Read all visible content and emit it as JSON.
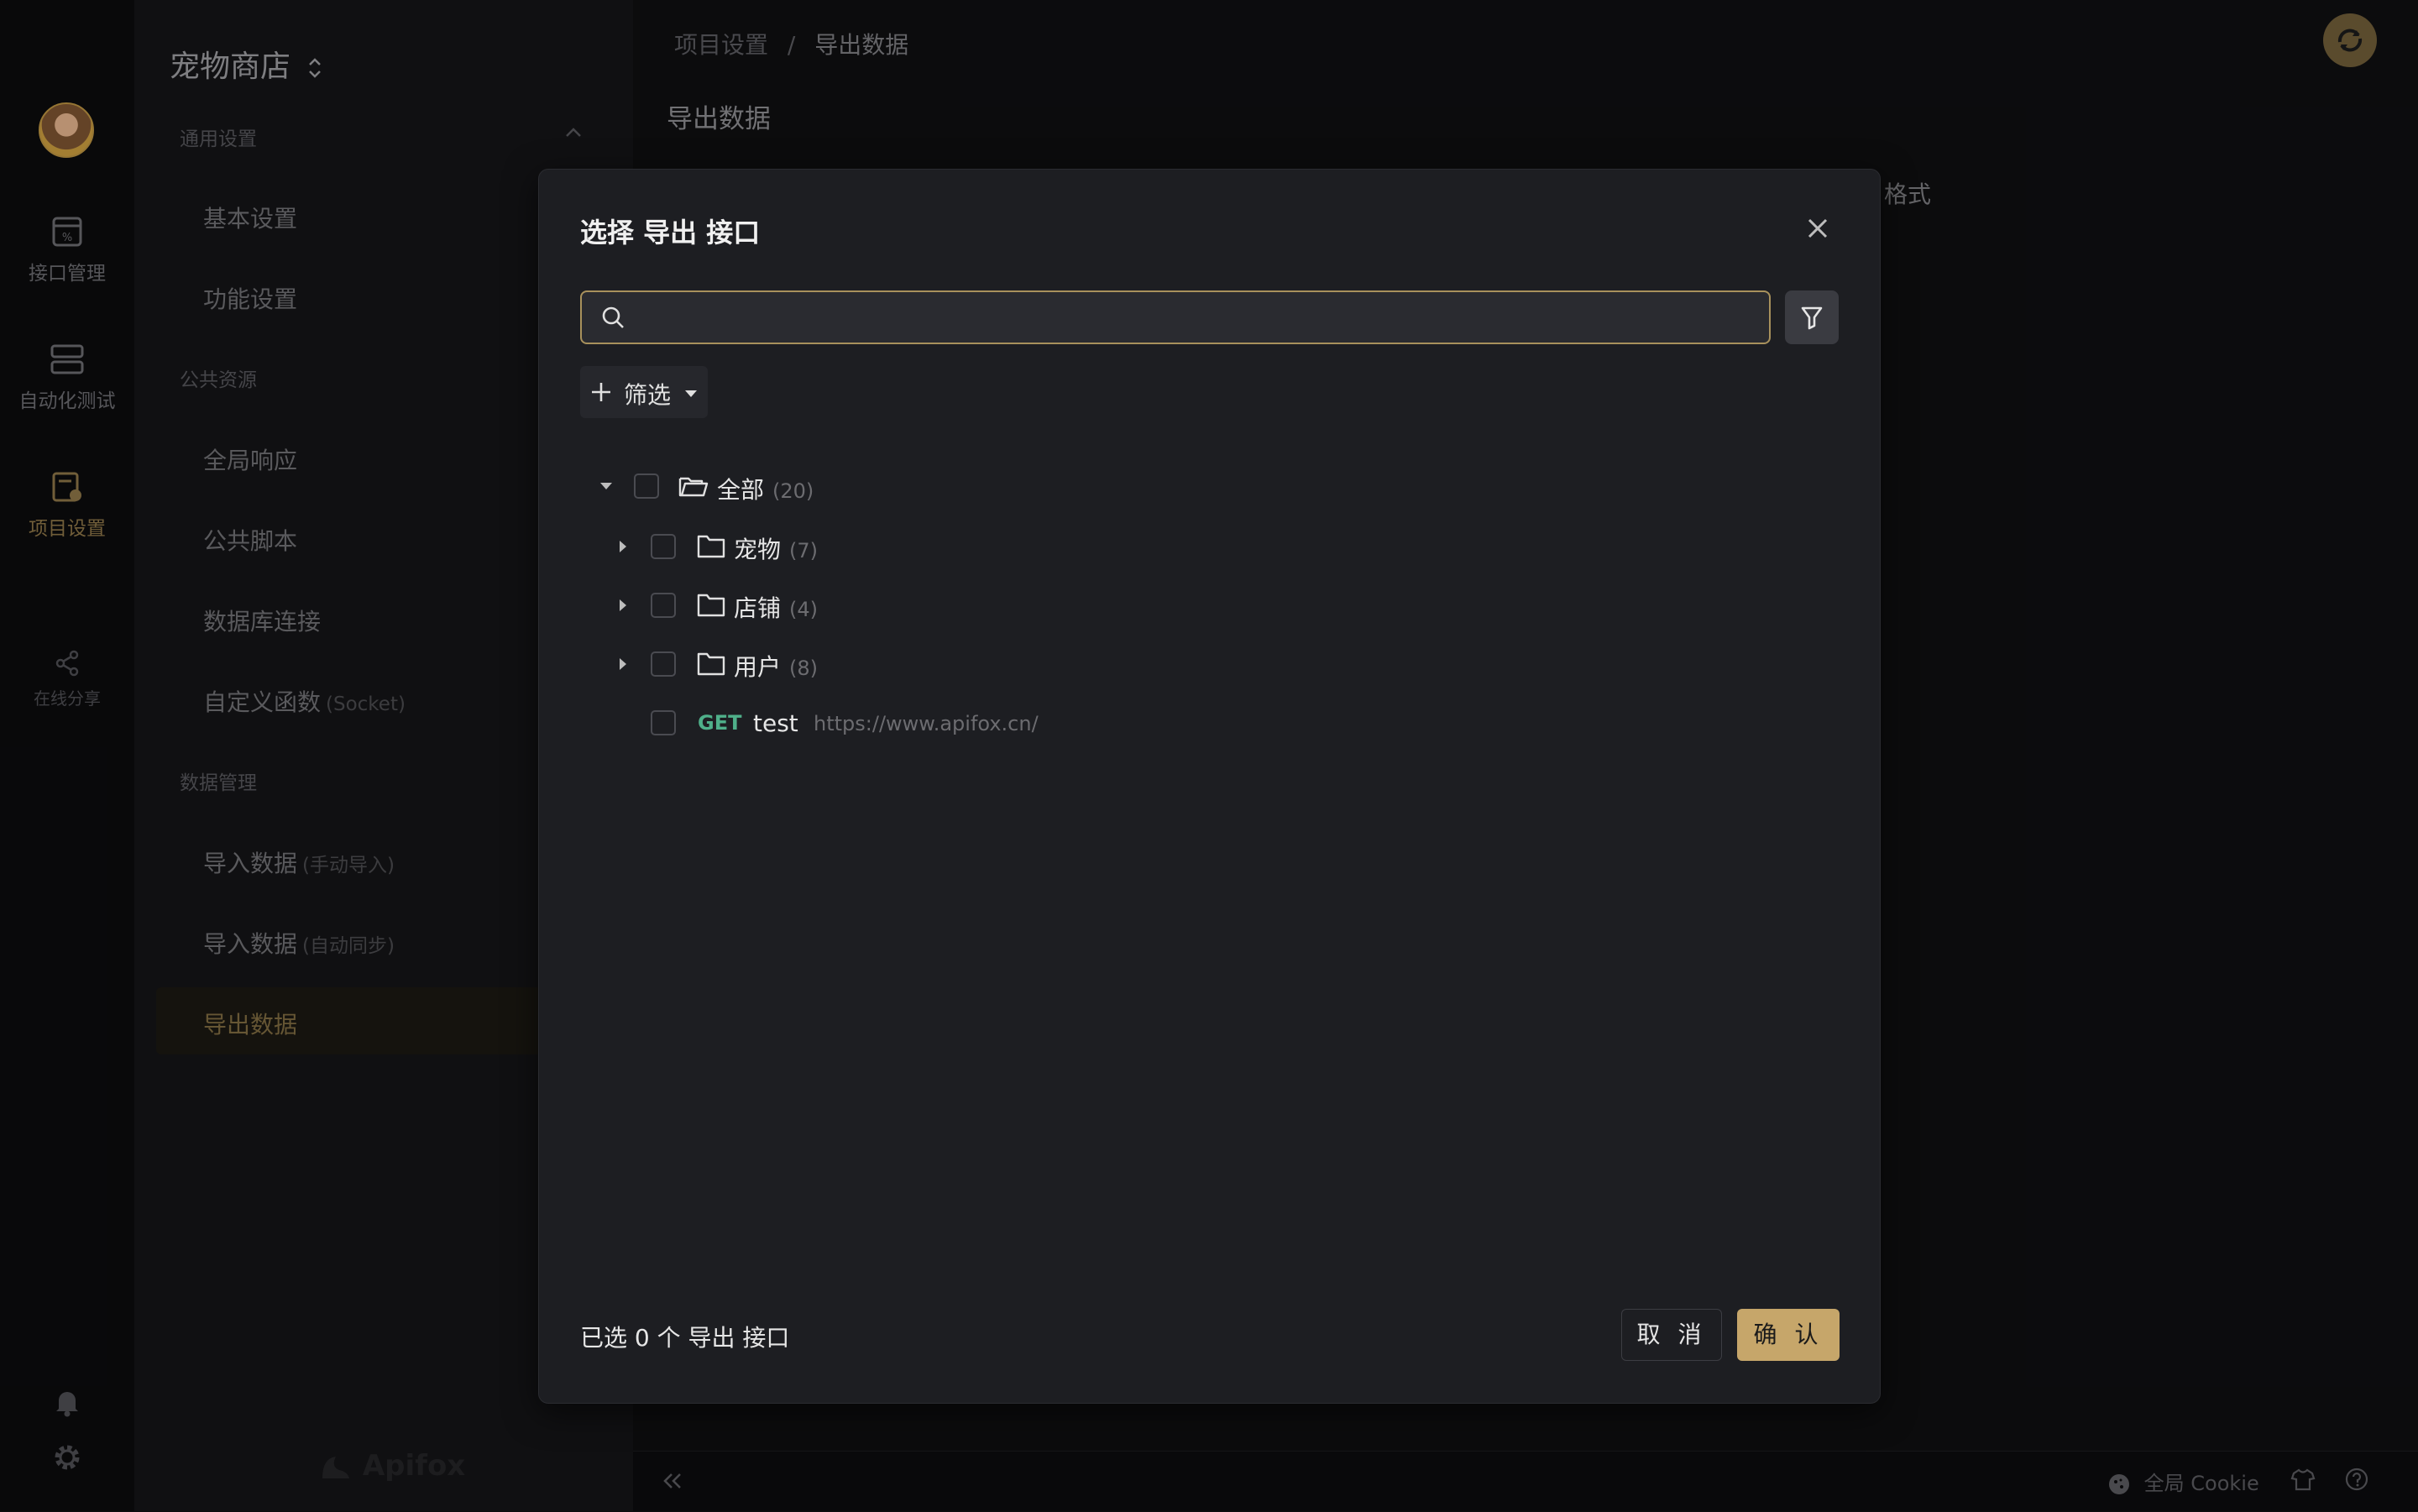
{
  "window": {
    "traffic_colors": [
      "#ff5f57",
      "#febc2e",
      "#28c840"
    ]
  },
  "rail": {
    "items": [
      {
        "label": "接口管理",
        "icon": "api-management-icon"
      },
      {
        "label": "自动化测试",
        "icon": "automation-test-icon"
      },
      {
        "label": "项目设置",
        "icon": "project-settings-icon",
        "active": true
      },
      {
        "label": "在线分享",
        "icon": "share-icon"
      }
    ],
    "bottom_icons": [
      "bell-icon",
      "gear-icon"
    ]
  },
  "sidebar": {
    "project_name": "宠物商店",
    "sections": [
      {
        "title": "通用设置",
        "items": [
          {
            "label": "基本设置"
          },
          {
            "label": "功能设置"
          }
        ]
      },
      {
        "title": "公共资源",
        "items": [
          {
            "label": "全局响应"
          },
          {
            "label": "公共脚本"
          },
          {
            "label": "数据库连接"
          },
          {
            "label": "自定义函数",
            "suffix": "(Socket)"
          }
        ]
      },
      {
        "title": "数据管理",
        "items": [
          {
            "label": "导入数据",
            "suffix": "(手动导入)"
          },
          {
            "label": "导入数据",
            "suffix": "(自动同步)"
          },
          {
            "label": "导出数据",
            "active": true
          }
        ]
      }
    ],
    "watermark": "Apifox"
  },
  "main": {
    "breadcrumb": [
      "项目设置",
      "/",
      "导出数据"
    ],
    "page_title": "导出数据",
    "partial_text": "格式"
  },
  "statusbar": {
    "global_cookie": "全局 Cookie"
  },
  "modal": {
    "title": "选择 导出 接口",
    "search_placeholder": "",
    "filter_label": "筛选",
    "tree": {
      "root": {
        "label": "全部",
        "count": "(20)"
      },
      "folders": [
        {
          "label": "宠物",
          "count": "(7)"
        },
        {
          "label": "店铺",
          "count": "(4)"
        },
        {
          "label": "用户",
          "count": "(8)"
        }
      ],
      "endpoint": {
        "method": "GET",
        "name": "test",
        "url": "https://www.apifox.cn/"
      }
    },
    "footer_text": "已选 0 个 导出 接口",
    "cancel_label": "取 消",
    "confirm_label": "确 认"
  },
  "colors": {
    "accent": "#c6a66a",
    "method_get": "#4fb08a",
    "modal_bg": "#1d1e22"
  }
}
